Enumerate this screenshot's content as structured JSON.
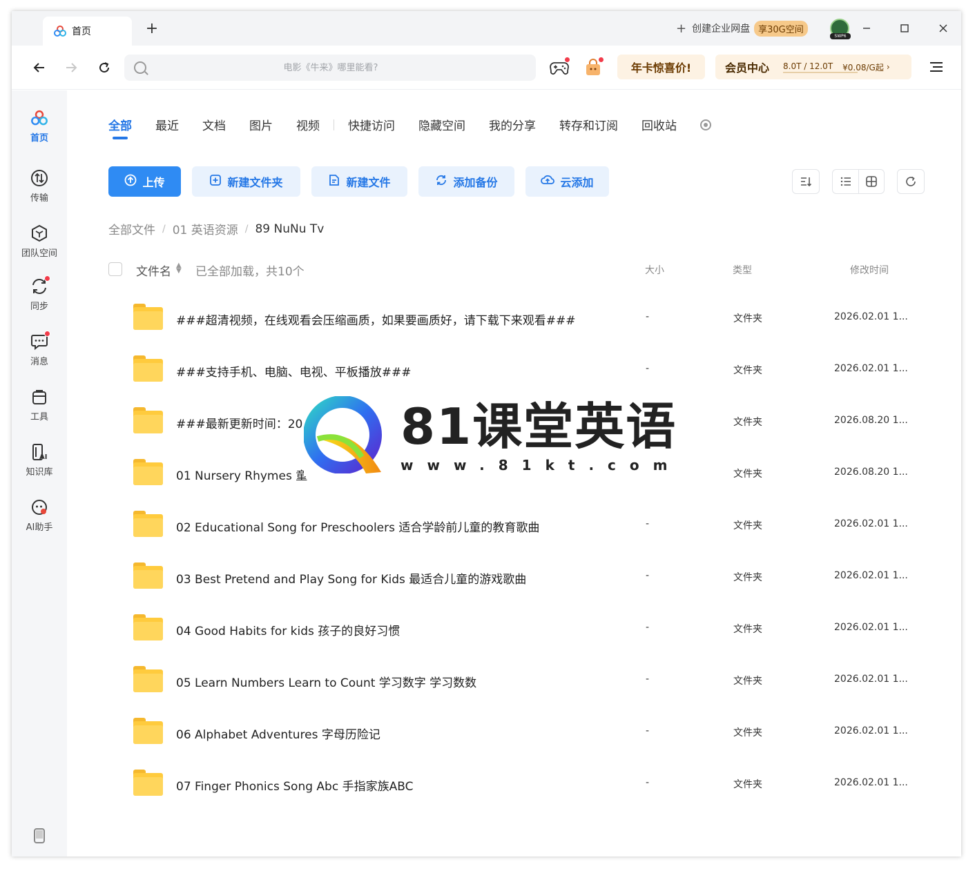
{
  "titlebar": {
    "tab_label": "首页",
    "new_tab": "+",
    "enterprise_label": "创建企业网盘",
    "enterprise_badge": "享30G空间",
    "avatar_tag": "SWP6"
  },
  "nav": {
    "search_placeholder": "电影《牛来》哪里能看?",
    "promo_label": "年卡惊喜价!",
    "vip_label": "会员中心",
    "quota": "8.0T / 12.0T",
    "quota_fraction": 0.667,
    "price": "¥0.08/G起"
  },
  "sidebar": {
    "items": [
      {
        "label": "首页",
        "icon": "home-logo-icon"
      },
      {
        "label": "传输",
        "icon": "transfer-icon"
      },
      {
        "label": "团队空间",
        "icon": "team-space-icon"
      },
      {
        "label": "同步",
        "icon": "sync-icon"
      },
      {
        "label": "消息",
        "icon": "message-icon"
      },
      {
        "label": "工具",
        "icon": "toolbox-icon"
      },
      {
        "label": "知识库",
        "icon": "knowledge-base-icon"
      },
      {
        "label": "AI助手",
        "icon": "ai-assistant-icon"
      }
    ]
  },
  "categories": [
    "全部",
    "最近",
    "文档",
    "图片",
    "视频",
    "快捷访问",
    "隐藏空间",
    "我的分享",
    "转存和订阅",
    "回收站"
  ],
  "actions": {
    "upload": "上传",
    "new_folder": "新建文件夹",
    "new_file": "新建文件",
    "add_backup": "添加备份",
    "cloud_add": "云添加"
  },
  "breadcrumb": [
    "全部文件",
    "01 英语资源",
    "89 NuNu Tv"
  ],
  "list_header": {
    "name": "文件名",
    "loaded": "已全部加载，共10个",
    "size": "大小",
    "type": "类型",
    "mtime": "修改时间"
  },
  "files": [
    {
      "name": "###超清视频，在线观看会压缩画质，如果要画质好，请下载下来观看###",
      "size": "-",
      "type": "文件夹",
      "mtime": "2026.02.01 1..."
    },
    {
      "name": "###支持手机、电脑、电视、平板播放###",
      "size": "-",
      "type": "文件夹",
      "mtime": "2026.02.01 1..."
    },
    {
      "name": "###最新更新时间：20",
      "size": "",
      "type": "文件夹",
      "mtime": "2026.08.20 1..."
    },
    {
      "name": "01 Nursery Rhymes 童",
      "size": "",
      "type": "文件夹",
      "mtime": "2026.08.20 1..."
    },
    {
      "name": "02 Educational Song for Preschoolers 适合学龄前儿童的教育歌曲",
      "size": "-",
      "type": "文件夹",
      "mtime": "2026.02.01 1..."
    },
    {
      "name": "03 Best Pretend and Play Song for Kids 最适合儿童的游戏歌曲",
      "size": "-",
      "type": "文件夹",
      "mtime": "2026.02.01 1..."
    },
    {
      "name": "04 Good Habits for kids 孩子的良好习惯",
      "size": "-",
      "type": "文件夹",
      "mtime": "2026.02.01 1..."
    },
    {
      "name": "05 Learn Numbers Learn to Count 学习数字 学习数数",
      "size": "-",
      "type": "文件夹",
      "mtime": "2026.02.01 1..."
    },
    {
      "name": "06 Alphabet Adventures 字母历险记",
      "size": "-",
      "type": "文件夹",
      "mtime": "2026.02.01 1..."
    },
    {
      "name": "07 Finger Phonics Song Abc 手指家族ABC",
      "size": "-",
      "type": "文件夹",
      "mtime": "2026.02.01 1..."
    }
  ],
  "watermark": {
    "title": "81课堂英语",
    "url": "www.81kt.com"
  },
  "colors": {
    "accent": "#2477e6",
    "primary_button": "#2f8bf3",
    "folder": "#ffcb3d",
    "promo_bg": "#fdf2e3",
    "notification_dot": "#f23b4a"
  }
}
